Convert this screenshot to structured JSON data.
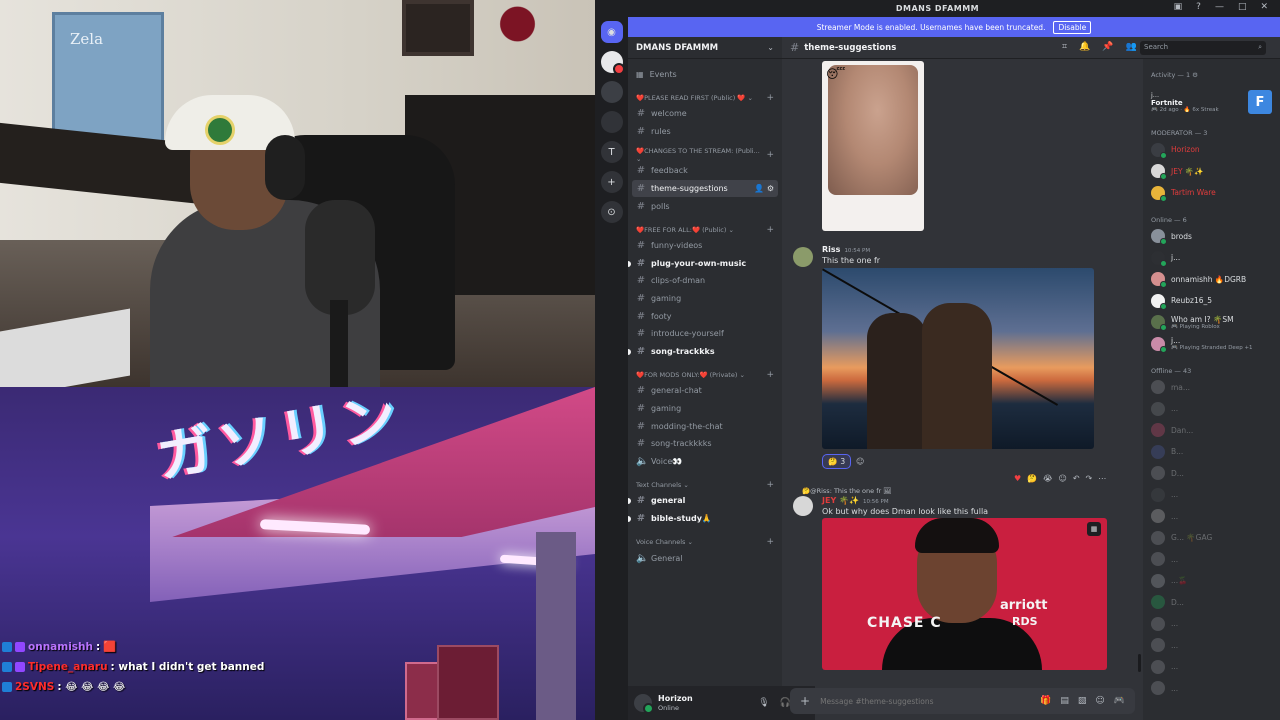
{
  "chat_overlay": [
    {
      "name": "onnamishh",
      "color": "#b974ff",
      "message": "🟥"
    },
    {
      "name": "Tipene_anaru",
      "color": "#ff2d2d",
      "message": ": what I didn't get banned"
    },
    {
      "name": "2SVNS",
      "color": "#ff2d2d",
      "message": ": 😂 😂 😂 😂"
    }
  ],
  "game_sign": "ガソリン",
  "webcam_box_text": "Zela",
  "discord": {
    "window_title": "DMANS DFAMMM",
    "banner": {
      "text": "Streamer Mode is enabled. Usernames have been truncated.",
      "button": "Disable"
    },
    "server_name": "DMANS DFAMMM",
    "events": "Events",
    "categories": [
      {
        "label": "❤️PLEASE READ FIRST (Public) ❤️ ⌄",
        "channels": [
          {
            "name": "welcome",
            "unread": false
          },
          {
            "name": "rules",
            "unread": false
          }
        ]
      },
      {
        "label": "❤️CHANGES TO THE STREAM: (Publi... ⌄",
        "channels": [
          {
            "name": "feedback",
            "unread": false
          },
          {
            "name": "theme-suggestions",
            "unread": false,
            "active": true
          },
          {
            "name": "polls",
            "unread": false
          }
        ]
      },
      {
        "label": "❤️FREE FOR ALL:❤️ (Public) ⌄",
        "channels": [
          {
            "name": "funny-videos",
            "unread": false
          },
          {
            "name": "plug-your-own-music",
            "unread": true
          },
          {
            "name": "clips-of-dman",
            "unread": false
          },
          {
            "name": "gaming",
            "unread": false
          },
          {
            "name": "footy",
            "unread": false
          },
          {
            "name": "introduce-yourself",
            "unread": false
          },
          {
            "name": "song-trackkks",
            "unread": true
          }
        ]
      },
      {
        "label": "❤️FOR MODS ONLY:❤️ (Private) ⌄",
        "channels": [
          {
            "name": "general-chat",
            "unread": false
          },
          {
            "name": "gaming",
            "unread": false
          },
          {
            "name": "modding-the-chat",
            "unread": false
          },
          {
            "name": "song-trackkkks",
            "unread": false
          },
          {
            "name": "Voice👀",
            "unread": false,
            "voice": true
          }
        ]
      },
      {
        "label": "Text Channels ⌄",
        "channels": [
          {
            "name": "general",
            "unread": true
          },
          {
            "name": "bible-study🙏",
            "unread": true
          }
        ]
      },
      {
        "label": "Voice Channels ⌄",
        "channels": [
          {
            "name": "General",
            "unread": false,
            "voice": true
          }
        ]
      }
    ],
    "user": {
      "name": "Horizon",
      "status": "Online"
    },
    "channel_title": "theme-suggestions",
    "search_placeholder": "Search",
    "messages": {
      "riss": {
        "author": "Riss",
        "time": "10:54 PM",
        "text": "This the one fr"
      },
      "reaction": {
        "emoji": "🤔",
        "count": "3"
      },
      "reply": {
        "text": "🤔@Riss: This the one fr 🖼"
      },
      "jey": {
        "author": "JEY 🌴✨",
        "time": "10:56 PM",
        "text": "Ok but why does Dman look like this fulla"
      },
      "image3_text": {
        "sponsor": "CHASE C",
        "logo": "arriott",
        "sub": "RDS"
      }
    },
    "composer_placeholder": "Message #theme-suggestions",
    "members": {
      "activity_header": "Activity — 1 ⚙",
      "activity": {
        "user": "j...",
        "game": "Fortnite",
        "detail": "🎮 2d ago · 🔥 6x Streak",
        "icon": "F"
      },
      "moderator_header": "MODERATOR — 3",
      "moderators": [
        {
          "name": "Horizon",
          "color": "#e03c3c",
          "avatar": "#3a3d43"
        },
        {
          "name": "JEY 🌴✨",
          "color": "#e03c3c",
          "avatar": "#d8d8d8"
        },
        {
          "name": "Tartim Ware",
          "color": "#e03c3c",
          "avatar": "#e8b43a"
        }
      ],
      "online_header": "Online — 6",
      "online": [
        {
          "name": "brods",
          "sub": "",
          "avatar": "#88909a"
        },
        {
          "name": "j...",
          "sub": "",
          "avatar": "#2d2f33"
        },
        {
          "name": "onnamishh 🔥DGRB",
          "sub": "",
          "avatar": "#d48f8f"
        },
        {
          "name": "Reubz16_5",
          "sub": "",
          "avatar": "#f2f2f2"
        },
        {
          "name": "Who am I? 🌴SM",
          "sub": "🎮 Playing Roblox",
          "avatar": "#59704b"
        },
        {
          "name": "j...",
          "sub": "🎮 Playing Stranded Deep +1",
          "avatar": "#c98ba8"
        }
      ],
      "offline_header": "Offline — 43",
      "offline": [
        {
          "name": "ma...",
          "avatar": "#8a8d93"
        },
        {
          "name": "...",
          "avatar": "#777a80"
        },
        {
          "name": "Dan...",
          "avatar": "#c44c6f"
        },
        {
          "name": "B...",
          "avatar": "#4c5b9e"
        },
        {
          "name": "D...",
          "avatar": "#8a8d93"
        },
        {
          "name": "...",
          "avatar": "#4a4d53"
        },
        {
          "name": "...",
          "avatar": "#b5b5b5"
        },
        {
          "name": "G... 🌴GAG",
          "avatar": "#8a8d93"
        },
        {
          "name": "...",
          "avatar": "#8a8d93"
        },
        {
          "name": "...🍒",
          "avatar": "#9aa0a6"
        },
        {
          "name": "D...",
          "avatar": "#23a55a"
        },
        {
          "name": "...",
          "avatar": "#8a8d93"
        },
        {
          "name": "...",
          "avatar": "#8a8d93"
        },
        {
          "name": "...",
          "avatar": "#8a8d93"
        },
        {
          "name": "...",
          "avatar": "#8a8d93"
        }
      ]
    }
  }
}
